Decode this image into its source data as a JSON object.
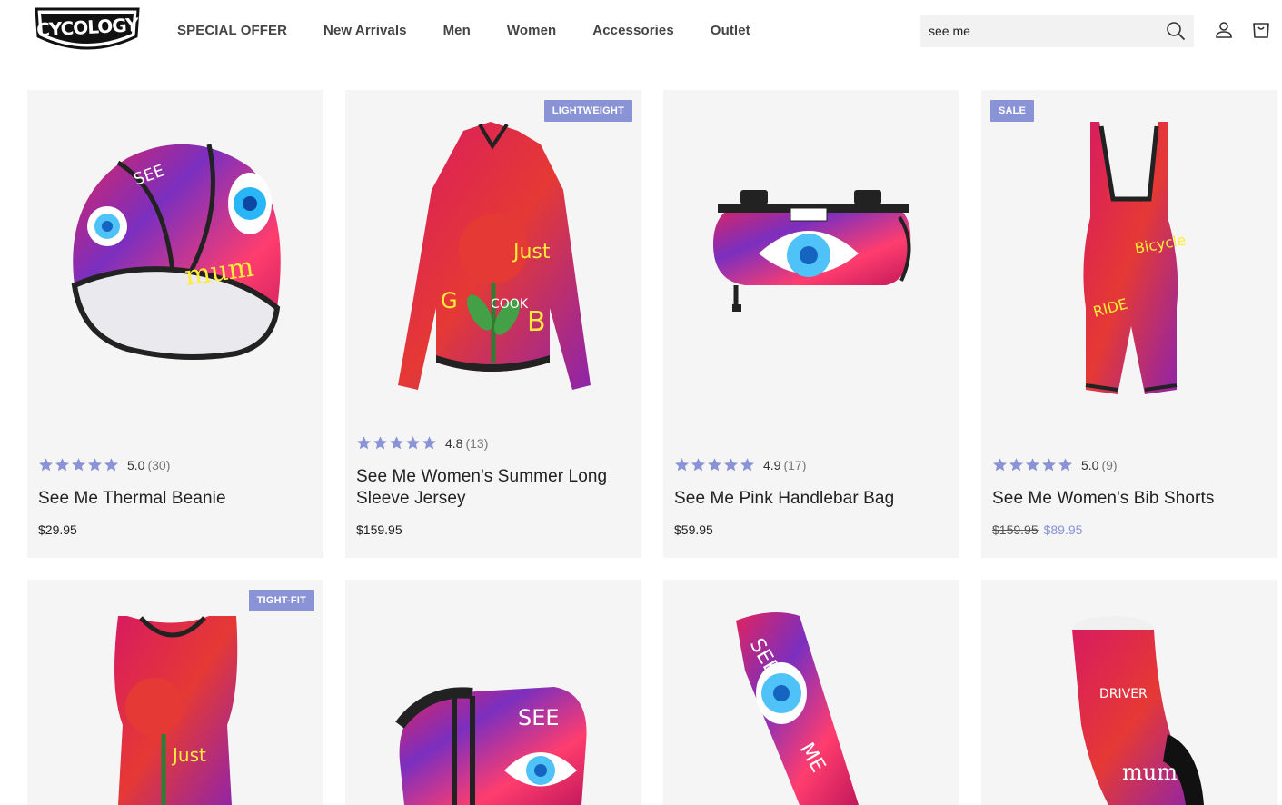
{
  "brand": {
    "logo_text": "CYCOLOGY"
  },
  "nav": {
    "items": [
      "SPECIAL OFFER",
      "New Arrivals",
      "Men",
      "Women",
      "Accessories",
      "Outlet"
    ]
  },
  "search": {
    "value": "see me",
    "placeholder": "Search"
  },
  "header_icons": [
    "search-icon",
    "account-icon",
    "cart-icon"
  ],
  "colors": {
    "accent": "#8a93d6",
    "card_bg": "#f5f5f5",
    "star": "#8a93d6"
  },
  "products": [
    {
      "name": "See Me Thermal Beanie",
      "rating": "5.0",
      "reviews": "(30)",
      "stars": 5,
      "price": "$29.95",
      "badge": ""
    },
    {
      "name": "See Me Women's Summer Long Sleeve Jersey",
      "rating": "4.8",
      "reviews": "(13)",
      "stars": 4.8,
      "price": "$159.95",
      "badge": "LIGHTWEIGHT"
    },
    {
      "name": "See Me Pink Handlebar Bag",
      "rating": "4.9",
      "reviews": "(17)",
      "stars": 4.9,
      "price": "$59.95",
      "badge": ""
    },
    {
      "name": "See Me Women's Bib Shorts",
      "rating": "5.0",
      "reviews": "(9)",
      "stars": 5,
      "price_old": "$159.95",
      "price": "$89.95",
      "badge": "SALE"
    },
    {
      "badge": "TIGHT-FIT"
    },
    {
      "badge": ""
    },
    {
      "badge": ""
    },
    {
      "badge": ""
    }
  ]
}
